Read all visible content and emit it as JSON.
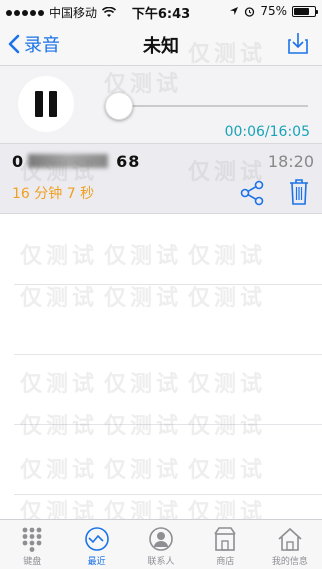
{
  "status_bar": {
    "carrier": "中国移动",
    "time": "下午6:43",
    "battery": "75%",
    "battery_level": 0.75
  },
  "nav": {
    "back_label": "录音",
    "title": "未知"
  },
  "player": {
    "time_display": "00:06/16:05",
    "progress": 0.0062
  },
  "recording": {
    "number_start": "0",
    "number_end": "68",
    "time": "18:20",
    "duration": "16 分钟 7 秒"
  },
  "watermark_text": "仅测试",
  "tabs": [
    {
      "label": "键盘",
      "icon": "keypad-icon",
      "active": false
    },
    {
      "label": "最近",
      "icon": "recents-clock-icon",
      "active": true
    },
    {
      "label": "联系人",
      "icon": "contacts-icon",
      "active": false
    },
    {
      "label": "商店",
      "icon": "store-icon",
      "active": false
    },
    {
      "label": "我的信息",
      "icon": "home-icon",
      "active": false
    }
  ],
  "colors": {
    "accent": "#1a73e8",
    "time_teal": "#1aa3b8",
    "duration_orange": "#f0a020"
  }
}
